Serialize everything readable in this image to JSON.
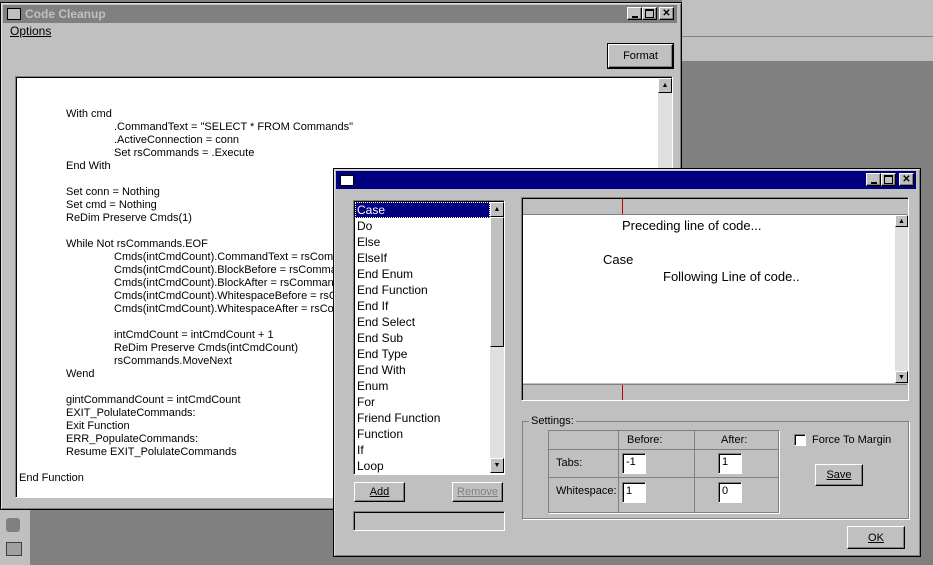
{
  "code_cleanup": {
    "title": "Code Cleanup",
    "menu_options": "Options",
    "format_label": "Format",
    "code_lines": [
      {
        "indent": 1,
        "text": "With cmd"
      },
      {
        "indent": 2,
        "text": ".CommandText = \"SELECT * FROM Commands\""
      },
      {
        "indent": 2,
        "text": ".ActiveConnection = conn"
      },
      {
        "indent": 2,
        "text": "Set rsCommands = .Execute"
      },
      {
        "indent": 1,
        "text": "End With"
      },
      {
        "indent": 1,
        "text": ""
      },
      {
        "indent": 1,
        "text": "Set conn = Nothing"
      },
      {
        "indent": 1,
        "text": "Set cmd = Nothing"
      },
      {
        "indent": 1,
        "text": "ReDim Preserve Cmds(1)"
      },
      {
        "indent": 1,
        "text": ""
      },
      {
        "indent": 1,
        "text": "While Not rsCommands.EOF"
      },
      {
        "indent": 2,
        "text": "Cmds(intCmdCount).CommandText = rsComma"
      },
      {
        "indent": 2,
        "text": "Cmds(intCmdCount).BlockBefore = rsCommanc"
      },
      {
        "indent": 2,
        "text": "Cmds(intCmdCount).BlockAfter = rsCommands."
      },
      {
        "indent": 2,
        "text": "Cmds(intCmdCount).WhitespaceBefore = rsCor"
      },
      {
        "indent": 2,
        "text": "Cmds(intCmdCount).WhitespaceAfter = rsComr"
      },
      {
        "indent": 2,
        "text": ""
      },
      {
        "indent": 2,
        "text": "intCmdCount = intCmdCount + 1"
      },
      {
        "indent": 2,
        "text": "ReDim Preserve Cmds(intCmdCount)"
      },
      {
        "indent": 2,
        "text": "rsCommands.MoveNext"
      },
      {
        "indent": 1,
        "text": "Wend"
      },
      {
        "indent": 1,
        "text": ""
      },
      {
        "indent": 1,
        "text": "gintCommandCount = intCmdCount"
      },
      {
        "indent": 1,
        "text": "EXIT_PolulateCommands:"
      },
      {
        "indent": 1,
        "text": "Exit Function"
      },
      {
        "indent": 1,
        "text": "ERR_PopulateCommands:"
      },
      {
        "indent": 1,
        "text": "Resume EXIT_PolulateCommands"
      },
      {
        "indent": 1,
        "text": ""
      },
      {
        "indent": 0,
        "text": "End Function"
      }
    ]
  },
  "dialog": {
    "commands": [
      "Case",
      "Do",
      "Else",
      "ElseIf",
      "End Enum",
      "End Function",
      "End If",
      "End Select",
      "End Sub",
      "End Type",
      "End With",
      "Enum",
      "For",
      "Friend Function",
      "Function",
      "If",
      "Loop"
    ],
    "selected_index": 0,
    "add_label": "Add",
    "remove_label": "Remove",
    "preview": {
      "preceding": "Preceding line of code...",
      "command": "Case",
      "following": "Following Line of code.."
    },
    "settings": {
      "group_label": "Settings:",
      "before_header": "Before:",
      "after_header": "After:",
      "tabs_label": "Tabs:",
      "whitespace_label": "Whitespace:",
      "tabs_before": "-1",
      "tabs_after": "1",
      "whitespace_before": "1",
      "whitespace_after": "0"
    },
    "force_to_margin_label": "Force To Margin",
    "force_to_margin_checked": false,
    "save_label": "Save",
    "ok_label": "OK"
  }
}
